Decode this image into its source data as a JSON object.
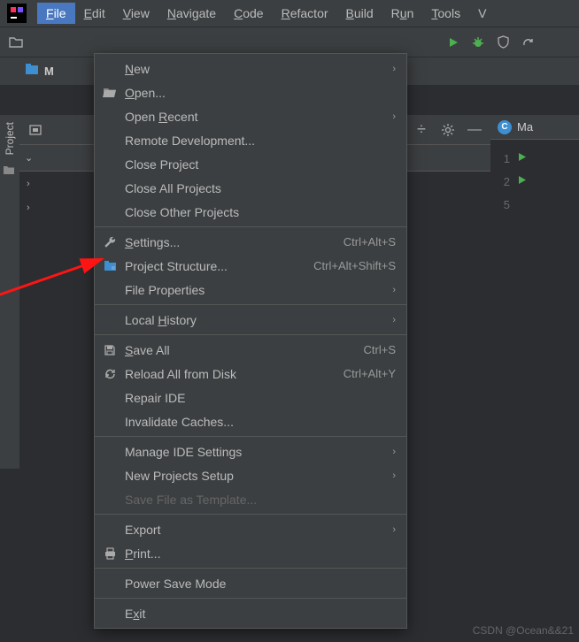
{
  "menubar": {
    "items": [
      {
        "label": "File",
        "underline": "F",
        "active": true
      },
      {
        "label": "Edit",
        "underline": "E"
      },
      {
        "label": "View",
        "underline": "V"
      },
      {
        "label": "Navigate",
        "underline": "N"
      },
      {
        "label": "Code",
        "underline": "C"
      },
      {
        "label": "Refactor",
        "underline": "R"
      },
      {
        "label": "Build",
        "underline": "B"
      },
      {
        "label": "Run",
        "underline": "u"
      },
      {
        "label": "Tools",
        "underline": "T"
      },
      {
        "label": "V",
        "underline": ""
      }
    ]
  },
  "breadcrumb": {
    "project_short": "M"
  },
  "sidebar": {
    "project_label": "Project"
  },
  "editor": {
    "tab_label": "Ma",
    "lines": [
      {
        "no": "1",
        "run": true
      },
      {
        "no": "2",
        "run": true
      },
      {
        "no": "5",
        "run": false
      }
    ]
  },
  "toolbar_right": {
    "run_icon": "run-icon",
    "debug_icon": "debug-icon",
    "coverage_icon": "coverage-icon",
    "update_icon": "update-icon"
  },
  "file_menu": {
    "groups": [
      [
        {
          "label": "New",
          "underline": "N",
          "submenu": true
        },
        {
          "label": "Open...",
          "underline": "O",
          "icon": "folder-open"
        },
        {
          "label": "Open Recent",
          "underline": "R",
          "submenu": true
        },
        {
          "label": "Remote Development..."
        },
        {
          "label": "Close Project"
        },
        {
          "label": "Close All Projects"
        },
        {
          "label": "Close Other Projects"
        }
      ],
      [
        {
          "label": "Settings...",
          "underline": "S",
          "shortcut": "Ctrl+Alt+S",
          "icon": "wrench"
        },
        {
          "label": "Project Structure...",
          "shortcut": "Ctrl+Alt+Shift+S",
          "icon": "project-structure"
        },
        {
          "label": "File Properties",
          "submenu": true
        }
      ],
      [
        {
          "label": "Local History",
          "underline": "H",
          "submenu": true
        }
      ],
      [
        {
          "label": "Save All",
          "underline": "S",
          "shortcut": "Ctrl+S",
          "icon": "save"
        },
        {
          "label": "Reload All from Disk",
          "shortcut": "Ctrl+Alt+Y",
          "icon": "reload"
        },
        {
          "label": "Repair IDE"
        },
        {
          "label": "Invalidate Caches..."
        }
      ],
      [
        {
          "label": "Manage IDE Settings",
          "submenu": true
        },
        {
          "label": "New Projects Setup",
          "submenu": true
        },
        {
          "label": "Save File as Template...",
          "disabled": true
        }
      ],
      [
        {
          "label": "Export",
          "submenu": true
        },
        {
          "label": "Print...",
          "underline": "P",
          "icon": "print"
        }
      ],
      [
        {
          "label": "Power Save Mode"
        }
      ],
      [
        {
          "label": "Exit",
          "underline": "x"
        }
      ]
    ]
  },
  "watermark": "CSDN @Ocean&&21"
}
